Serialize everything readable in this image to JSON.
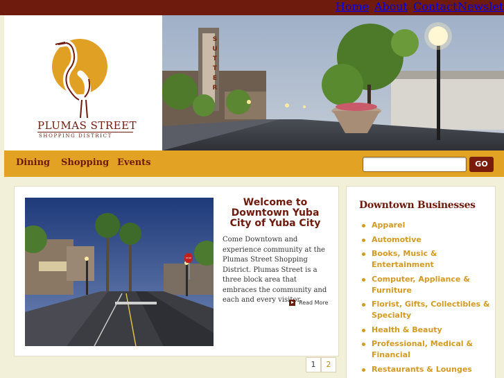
{
  "top_nav": {
    "items": [
      "Home",
      "About",
      "Contact",
      "Newsletters"
    ]
  },
  "logo": {
    "line1": "PLUMAS STREET",
    "line2": "SHOPPING DISTRICT"
  },
  "hero": {
    "sign_letters": [
      "S",
      "U",
      "T",
      "T",
      "E",
      "R"
    ]
  },
  "main_nav": {
    "items": [
      "Dining",
      "Shopping",
      "Events"
    ]
  },
  "search": {
    "placeholder": "",
    "button_label": "GO"
  },
  "feature": {
    "title": "Welcome to Downtown Yuba City of Yuba City",
    "body": "Come Downtown and experience community at the Plumas Street Shopping District. Plumas Street is a three block area that embraces the community and each and every visitor.",
    "read_more": "Read More",
    "pages": [
      "1",
      "2"
    ],
    "photo_sign": "STOP"
  },
  "sidebar": {
    "title": "Downtown Businesses",
    "items": [
      "Apparel",
      "Automotive",
      "Books, Music & Entertainment",
      "Computer, Appliance & Furniture",
      "Florist, Gifts, Collectibles & Specialty",
      "Health & Beauty",
      "Professional, Medical & Financial",
      "Restaurants & Lounges"
    ]
  },
  "colors": {
    "brand_maroon": "#6e1a0c",
    "brand_gold": "#e2a224",
    "link_gold": "#d39a22",
    "background": "#f3f0d9"
  }
}
